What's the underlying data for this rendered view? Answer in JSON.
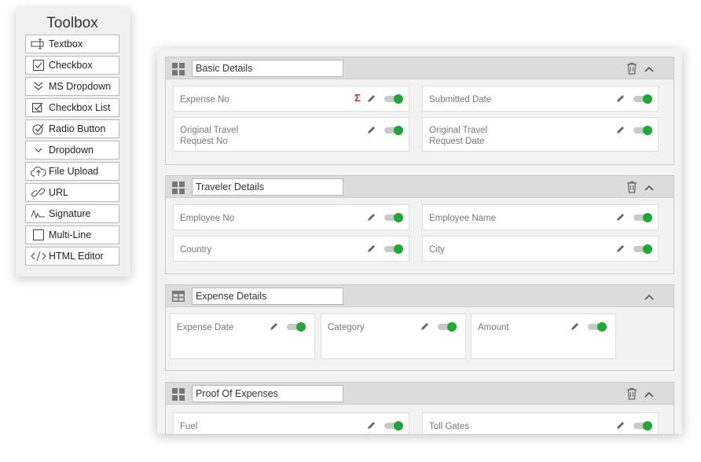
{
  "toolbox": {
    "title": "Toolbox",
    "items": [
      {
        "label": "Textbox",
        "icon": "textbox-icon"
      },
      {
        "label": "Checkbox",
        "icon": "checkbox-icon"
      },
      {
        "label": "MS Dropdown",
        "icon": "double-chevron-down-icon"
      },
      {
        "label": "Checkbox List",
        "icon": "checkbox-list-icon"
      },
      {
        "label": "Radio Button",
        "icon": "radio-button-icon"
      },
      {
        "label": "Dropdown",
        "icon": "chevron-down-icon"
      },
      {
        "label": "File Upload",
        "icon": "cloud-upload-icon"
      },
      {
        "label": "URL",
        "icon": "link-icon"
      },
      {
        "label": "Signature",
        "icon": "signature-icon"
      },
      {
        "label": "Multi-Line",
        "icon": "square-icon"
      },
      {
        "label": "HTML Editor",
        "icon": "code-icon"
      }
    ]
  },
  "sections": [
    {
      "title": "Basic Details",
      "icon": "grid-icon",
      "fields": [
        {
          "label": "Expense No",
          "sigma": "Σ"
        },
        {
          "label": "Submitted Date"
        },
        {
          "label": "Original Travel Request No"
        },
        {
          "label": "Original Travel Request Date"
        }
      ]
    },
    {
      "title": "Traveler Details",
      "icon": "grid-icon",
      "fields": [
        {
          "label": "Employee No"
        },
        {
          "label": "Employee Name"
        },
        {
          "label": "Country"
        },
        {
          "label": "City"
        }
      ]
    },
    {
      "title": "Expense Details",
      "icon": "table-icon",
      "fields": [
        {
          "label": "Expense Date"
        },
        {
          "label": "Category"
        },
        {
          "label": "Amount"
        }
      ]
    },
    {
      "title": "Proof Of Expenses",
      "icon": "grid-icon",
      "fields": [
        {
          "label": "Fuel"
        },
        {
          "label": "Toll Gates"
        }
      ]
    }
  ],
  "colors": {
    "toggle_on": "#1fa834",
    "sigma": "#cc2a2a",
    "header_bg": "#dcdcdc"
  }
}
